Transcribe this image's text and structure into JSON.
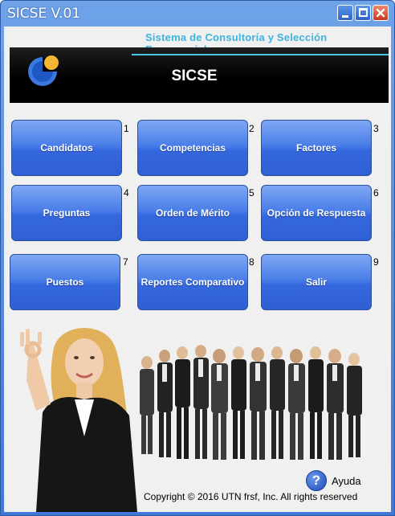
{
  "window": {
    "title": "SICSE V.01",
    "controls": {
      "minimize_icon": "minimize-icon",
      "maximize_icon": "maximize-icon",
      "close_icon": "close-icon"
    }
  },
  "header": {
    "subtitle": "Sistema de Consultoría y Selección Empresarial",
    "banner_title": "SICSE",
    "logo_icon": "pie-logo-icon"
  },
  "menu": [
    {
      "label": "Candidatos",
      "number": "1"
    },
    {
      "label": "Competencias",
      "number": "2"
    },
    {
      "label": "Factores",
      "number": "3"
    },
    {
      "label": "Preguntas",
      "number": "4"
    },
    {
      "label": "Orden de Mérito",
      "number": "5"
    },
    {
      "label": "Opción de Respuesta",
      "number": "6"
    },
    {
      "label": "Puestos",
      "number": "7"
    },
    {
      "label": "Reportes Comparativo",
      "number": "8"
    },
    {
      "label": "Salir",
      "number": "9"
    }
  ],
  "footer": {
    "help_label": "Ayuda",
    "help_icon": "help-question-icon",
    "copyright": "Copyright © 2016 UTN frsf, Inc. All rights reserved"
  },
  "colors": {
    "titlebar": "#3f78d6",
    "button_blue": "#3567de",
    "accent_cyan": "#3fb3dd",
    "banner_black": "#000000"
  }
}
